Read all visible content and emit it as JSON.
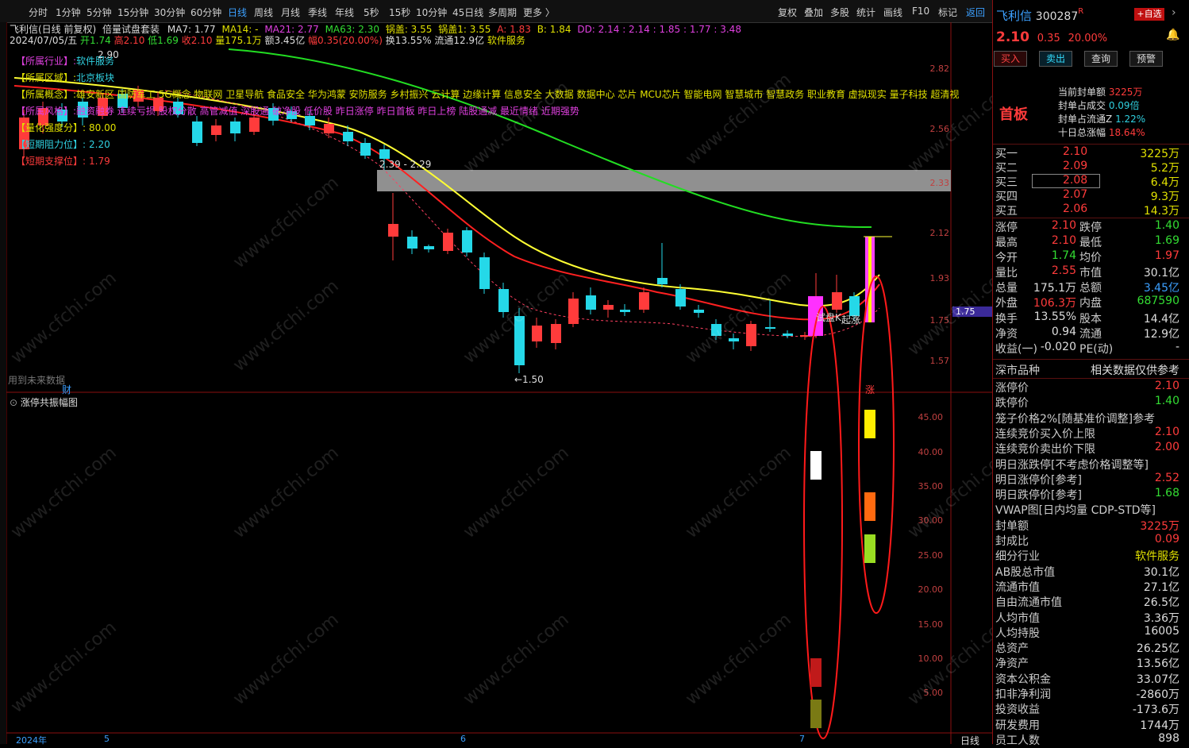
{
  "toolbar": {
    "periods": [
      "分时",
      "1分钟",
      "5分钟",
      "15分钟",
      "30分钟",
      "60分钟",
      "日线",
      "周线",
      "月线",
      "季线",
      "年线",
      "5秒",
      "15秒",
      "10分钟",
      "45日线",
      "多周期",
      "更多 〉"
    ],
    "selected_period": "日线",
    "tools": [
      "复权",
      "叠加",
      "多股",
      "统计",
      "画线",
      "F10",
      "标记",
      "返回"
    ]
  },
  "chart_header": {
    "title": "飞利信(日线 前复权)",
    "indicator_set": "倍量试盘套装",
    "ma7": "MA7: 1.77",
    "ma14": "MA14: -",
    "ma21": "MA21: 2.77",
    "ma63": "MA63: 2.30",
    "guogai": "锅盖: 3.55",
    "guogai1": "锅盖1: 3.55",
    "a": "A: 1.83",
    "b": "B: 1.84",
    "dd": "DD: 2.14 : 2.14 : 1.85 : 1.77 : 3.48"
  },
  "day_line": {
    "date": "2024/07/05/五",
    "open": "开1.74",
    "high": "高2.10",
    "low": "低1.69",
    "close": "收2.10",
    "volume": "量175.1万",
    "amount": "额3.45亿",
    "change": "幅0.35(20.00%)",
    "turnover": "换13.55%",
    "float": "流通12.9亿",
    "industry": "软件服务"
  },
  "overlay_info": [
    {
      "label": "【所属行业】:",
      "value": "软件服务"
    },
    {
      "label": "【所属区域】:",
      "value": "北京板块"
    },
    {
      "label": "【所属概念】:",
      "value": "雄安新区 国防军工 5G概念 物联网 卫星导航 食品安全 华为鸿蒙 安防服务 乡村振兴 云计算 边缘计算 信息安全 大数据 数据中心 芯片 MCU芯片 智能电网 智慧城市 智慧政务 职业教育 虚拟现实 量子科技 超清视"
    },
    {
      "label": "【所属风格】:",
      "value": "融资融券 连续亏损 股权分散 高管减值 深股通 破净股 低价股 昨日涨停 昨日首板 昨日上榜 陆股通减 最近情绪 近期强势"
    },
    {
      "label": "【量化强度分】:",
      "value": "80.00"
    },
    {
      "label": "【短期阻力位】:",
      "value": "2.20"
    },
    {
      "label": "【短期支撑位】:",
      "value": "1.79"
    }
  ],
  "main_yaxis": [
    "2.82",
    "2.56",
    "2.33",
    "2.12",
    "1.93",
    "1.75",
    "1.57"
  ],
  "current_price_tag": "1.75",
  "annotations": {
    "high_mark": "2.90",
    "range_label": "2.39 - 2.29",
    "low_mark": "←1.50",
    "tri_label": "试盘K",
    "jump_label": "起涨",
    "limit_label": "涨",
    "future_note": "用到未来数据",
    "cai": "财"
  },
  "sub_panel": {
    "title": "涨停共振幅图",
    "yaxis": [
      "45.00",
      "40.00",
      "35.00",
      "30.00",
      "25.00",
      "20.00",
      "15.00",
      "10.00",
      "5.00"
    ]
  },
  "bottom_axis": {
    "year": "2024年",
    "m5": "5",
    "m6": "6",
    "m7": "7",
    "period": "日线"
  },
  "panel": {
    "name": "飞利信",
    "code": "300287",
    "r_mark": "R",
    "add_btn": "+自选",
    "price": "2.10",
    "chg": "0.35",
    "pct": "20.00%",
    "buttons": [
      "买入",
      "卖出",
      "查询",
      "预警"
    ],
    "board": "首板",
    "seal_info": [
      {
        "k": "当前封单额",
        "v": "3225万"
      },
      {
        "k": "封单占成交",
        "v": "0.09倍"
      },
      {
        "k": "封单占流通Z",
        "v": "1.22%"
      },
      {
        "k": "十日总涨幅",
        "v": "18.64%"
      }
    ],
    "book": [
      {
        "k": "买一",
        "p": "2.10",
        "v": "3225万"
      },
      {
        "k": "买二",
        "p": "2.09",
        "v": "5.2万"
      },
      {
        "k": "买三",
        "p": "2.08",
        "v": "6.4万"
      },
      {
        "k": "买四",
        "p": "2.07",
        "v": "9.3万"
      },
      {
        "k": "买五",
        "p": "2.06",
        "v": "14.3万"
      }
    ],
    "stats": [
      {
        "k1": "涨停",
        "v1": "2.10",
        "c1": "red",
        "k2": "跌停",
        "v2": "1.40",
        "c2": "grn"
      },
      {
        "k1": "最高",
        "v1": "2.10",
        "c1": "red",
        "k2": "最低",
        "v2": "1.69",
        "c2": "grn"
      },
      {
        "k1": "今开",
        "v1": "1.74",
        "c1": "grn",
        "k2": "均价",
        "v2": "1.97",
        "c2": "red"
      },
      {
        "k1": "量比",
        "v1": "2.55",
        "c1": "red",
        "k2": "市值",
        "v2": "30.1亿",
        "c2": "wht"
      },
      {
        "k1": "总量",
        "v1": "175.1万",
        "c1": "wht",
        "k2": "总额",
        "v2": "3.45亿",
        "c2": "blue"
      },
      {
        "k1": "外盘",
        "v1": "106.3万",
        "c1": "red",
        "k2": "内盘",
        "v2": "687590",
        "c2": "grn"
      },
      {
        "k1": "换手",
        "v1": "13.55%",
        "c1": "wht",
        "k2": "股本",
        "v2": "14.4亿",
        "c2": "wht"
      },
      {
        "k1": "净资",
        "v1": "0.94",
        "c1": "wht",
        "k2": "流通",
        "v2": "12.9亿",
        "c2": "wht"
      },
      {
        "k1": "收益(一)",
        "v1": "-0.020",
        "c1": "wht",
        "k2": "PE(动)",
        "v2": "-",
        "c2": "wht"
      }
    ],
    "market_hdr_l": "深市品种",
    "market_hdr_r": "相关数据仅供参考",
    "extras": [
      {
        "k": "涨停价",
        "v": "2.10",
        "c": "red"
      },
      {
        "k": "跌停价",
        "v": "1.40",
        "c": "grn"
      },
      {
        "k": "笼子价格2%[随基准价调整]参考",
        "v": "",
        "c": "wht"
      },
      {
        "k": "连续竞价买入价上限",
        "v": "2.10",
        "c": "red"
      },
      {
        "k": "连续竞价卖出价下限",
        "v": "2.00",
        "c": "red"
      },
      {
        "k": "明日涨跌停[不考虑价格调整等]",
        "v": "",
        "c": "wht"
      },
      {
        "k": "明日涨停价[参考]",
        "v": "2.52",
        "c": "red"
      },
      {
        "k": "明日跌停价[参考]",
        "v": "1.68",
        "c": "grn"
      },
      {
        "k": "VWAP图[日内均量 CDP-STD等]",
        "v": "",
        "c": "wht"
      },
      {
        "k": "封单额",
        "v": "3225万",
        "c": "red"
      },
      {
        "k": "封成比",
        "v": "0.09",
        "c": "red"
      },
      {
        "k": "细分行业",
        "v": "软件服务",
        "c": "yel"
      },
      {
        "k": "AB股总市值",
        "v": "30.1亿",
        "c": "wht"
      },
      {
        "k": "流通市值",
        "v": "27.1亿",
        "c": "wht"
      },
      {
        "k": "自由流通市值",
        "v": "26.5亿",
        "c": "wht"
      },
      {
        "k": "人均市值",
        "v": "3.36万",
        "c": "wht"
      },
      {
        "k": "人均持股",
        "v": "16005",
        "c": "wht"
      },
      {
        "k": "总资产",
        "v": "26.25亿",
        "c": "wht"
      },
      {
        "k": "净资产",
        "v": "13.56亿",
        "c": "wht"
      },
      {
        "k": "资本公积金",
        "v": "33.07亿",
        "c": "wht"
      },
      {
        "k": "扣非净利润",
        "v": "-2860万",
        "c": "wht"
      },
      {
        "k": "投资收益",
        "v": "-173.6万",
        "c": "wht"
      },
      {
        "k": "研发费用",
        "v": "1744万",
        "c": "wht"
      },
      {
        "k": "员工人数",
        "v": "898",
        "c": "wht"
      }
    ]
  },
  "watermark": "www.cfchi.com",
  "colors": {
    "up": "#ff3b3b",
    "down": "#25d8e8",
    "ma_yellow": "#ffff33",
    "ma_red": "#ff2020",
    "ma_green": "#22dd22",
    "ellipse": "#ff1a1a"
  }
}
